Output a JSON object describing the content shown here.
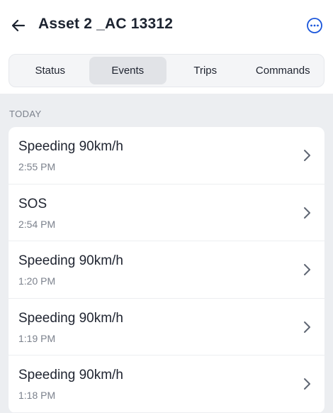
{
  "header": {
    "title": "Asset 2 _AC 13312",
    "back_icon": "arrow-left-icon",
    "more_icon": "more-horizontal-circle-icon",
    "accent_color": "#1a56db"
  },
  "tabs": [
    {
      "label": "Status",
      "active": false
    },
    {
      "label": "Events",
      "active": true
    },
    {
      "label": "Trips",
      "active": false
    },
    {
      "label": "Commands",
      "active": false
    }
  ],
  "events": {
    "section_label": "TODAY",
    "items": [
      {
        "title": "Speeding 90km/h",
        "time": "2:55 PM"
      },
      {
        "title": "SOS",
        "time": "2:54 PM"
      },
      {
        "title": "Speeding 90km/h",
        "time": "1:20 PM"
      },
      {
        "title": "Speeding 90km/h",
        "time": "1:19 PM"
      },
      {
        "title": "Speeding 90km/h",
        "time": "1:18 PM"
      }
    ]
  }
}
